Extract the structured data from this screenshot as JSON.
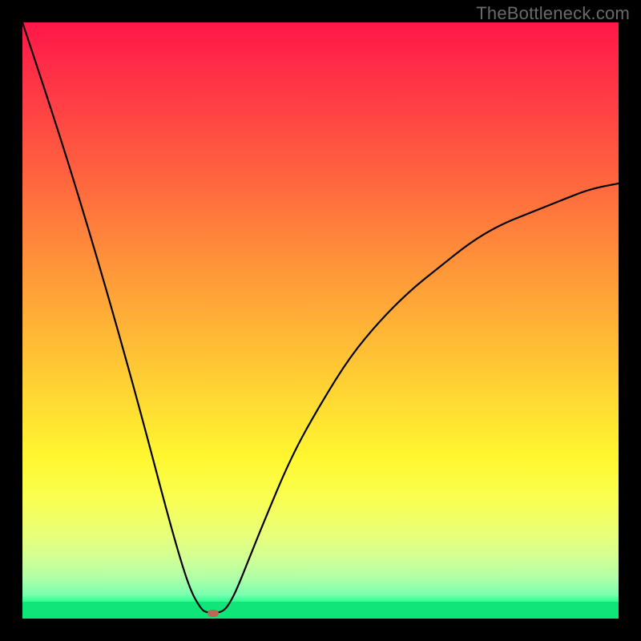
{
  "credit_text": "TheBottleneck.com",
  "chart_data": {
    "type": "line",
    "title": "",
    "xlabel": "",
    "ylabel": "",
    "xlim": [
      0,
      100
    ],
    "ylim": [
      0,
      100
    ],
    "grid": false,
    "series": [
      {
        "name": "bottleneck-curve",
        "x": [
          0,
          5,
          10,
          15,
          20,
          25,
          28,
          30,
          31,
          32,
          33,
          34,
          35,
          36,
          38,
          40,
          45,
          50,
          55,
          60,
          65,
          70,
          75,
          80,
          85,
          90,
          95,
          100
        ],
        "values": [
          100,
          85,
          69,
          52,
          34,
          15,
          5,
          1.5,
          1.0,
          1.0,
          1.0,
          1.5,
          3,
          5,
          10,
          15,
          27,
          36,
          44,
          50,
          55,
          59,
          63,
          66,
          68,
          70,
          72,
          73
        ]
      }
    ],
    "marker": {
      "x": 32,
      "y": 1.0,
      "color": "#b76b57"
    },
    "gradient": {
      "top_color": "#ff1748",
      "mid_color": "#fff730",
      "bottom_color": "#10e57a"
    }
  }
}
